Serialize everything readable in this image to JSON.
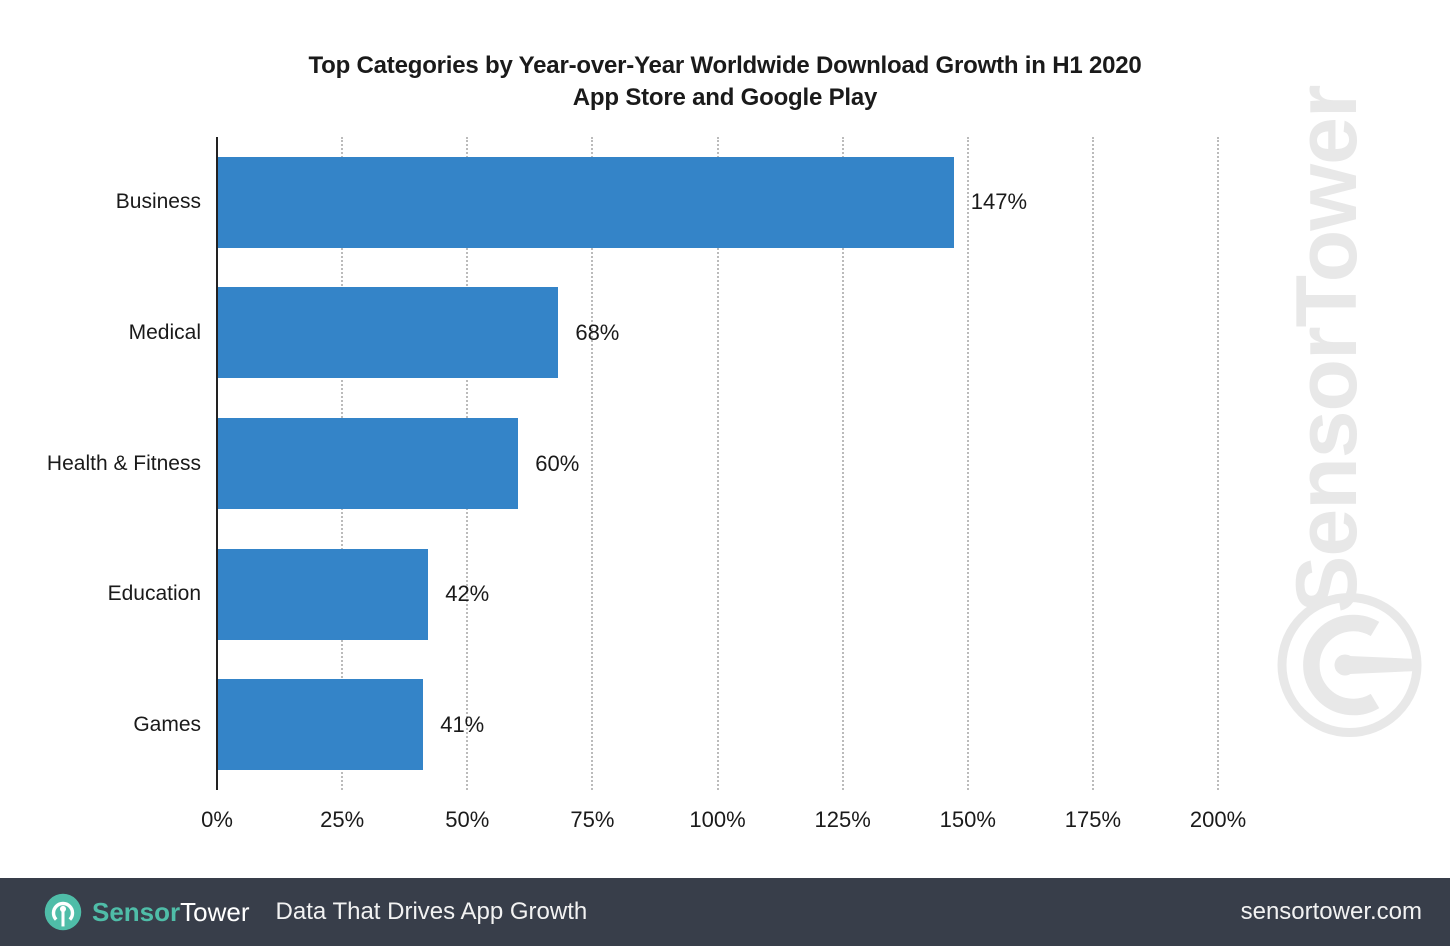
{
  "chart_data": {
    "type": "bar",
    "orientation": "horizontal",
    "title_line1": "Top Categories by Year-over-Year Worldwide Download Growth in H1 2020",
    "title_line2": "App Store and Google Play",
    "categories": [
      "Business",
      "Medical",
      "Health & Fitness",
      "Education",
      "Games"
    ],
    "values": [
      147,
      68,
      60,
      42,
      41
    ],
    "value_labels": [
      "147%",
      "68%",
      "60%",
      "42%",
      "41%"
    ],
    "xlabel": "",
    "ylabel": "",
    "xlim": [
      0,
      200
    ],
    "xticks": [
      0,
      25,
      50,
      75,
      100,
      125,
      150,
      175,
      200
    ],
    "xtick_labels": [
      "0%",
      "25%",
      "50%",
      "75%",
      "100%",
      "125%",
      "150%",
      "175%",
      "200%"
    ],
    "grid": "vertical-dotted",
    "legend": "none",
    "bar_color": "#3484c8",
    "text_color": "#1a1a1a",
    "grid_color": "#bbbbbb",
    "axis_color": "#222222"
  },
  "watermark": {
    "text": "SensorTower",
    "logo_icon": "sensor-tower-signal-icon",
    "color": "#e8e8e8"
  },
  "footer": {
    "background": "#383e4a",
    "logo_icon": "sensor-tower-signal-icon",
    "brand_part1": "Sensor",
    "brand_part2": "Tower",
    "brand_part1_color": "#4fbda8",
    "brand_part2_color": "#ffffff",
    "tagline": "Data That Drives App Growth",
    "url": "sensortower.com"
  }
}
